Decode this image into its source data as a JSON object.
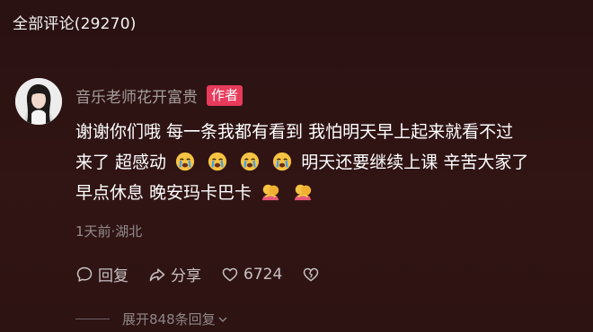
{
  "header": {
    "title": "全部评论(29270)"
  },
  "comment": {
    "username": "音乐老师花开富贵",
    "badge": "作者",
    "lines": [
      "谢谢你们哦 每一条我都有看到 我怕明天早上起来就看不过",
      "来了 超感动",
      "明天还要继续上课 辛苦大家了",
      "早点休息 晚安玛卡巴卡"
    ],
    "meta": "1天前·湖北",
    "actions": {
      "reply": "回复",
      "share": "分享",
      "likes": "6724"
    },
    "expand_label": "展开848条回复"
  },
  "icons": {
    "reply": "comment-bubble-icon",
    "share": "share-arrow-icon",
    "like": "heart-icon",
    "dislike": "broken-heart-icon",
    "crying_emoji": "crying-face-emoji-icon",
    "hug_emoji": "hug-emoji-icon",
    "expand": "chevron-down-icon"
  },
  "colors": {
    "badge": "#e83a5b",
    "background": "#2e1313"
  }
}
